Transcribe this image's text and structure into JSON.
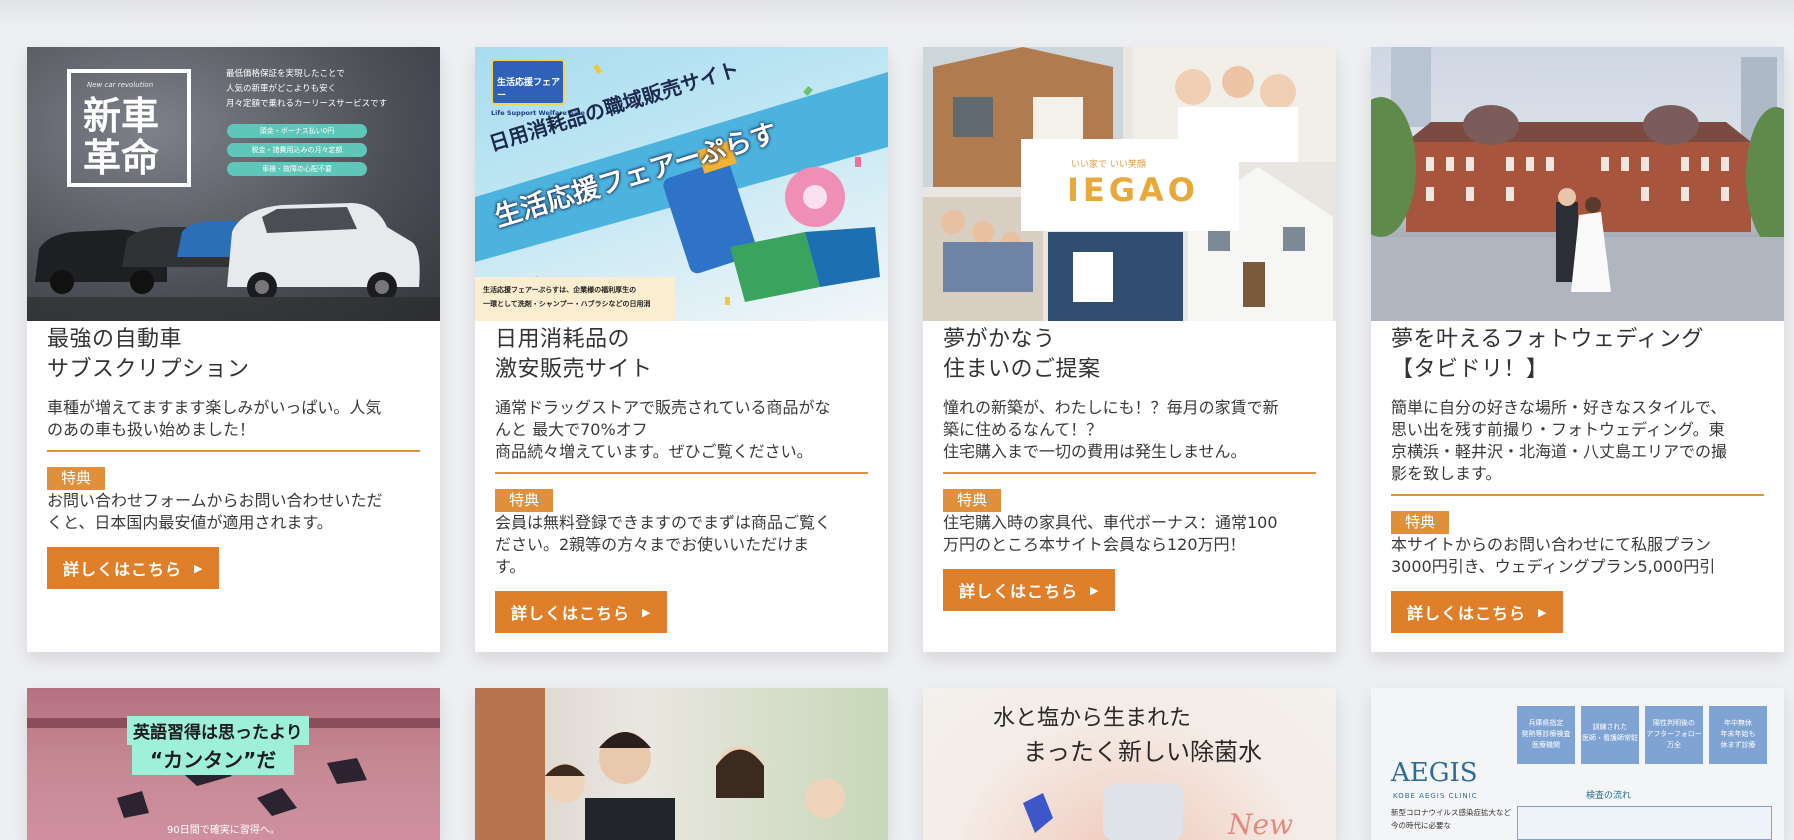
{
  "cards": [
    {
      "title": "最強の自動車\nサブスクリプション",
      "description": "車種が増えてますます楽しみがいっぱい。人気\nのあの車も扱い始めました！",
      "badge": "特典",
      "benefit": "お問い合わせフォームからお問い合わせいただ\nくと、日本国内最安値が適用されます。",
      "cta": "詳しくはこちら",
      "image": {
        "heading": "新車\n革命",
        "tagline": "New car revolution",
        "copy": "最低価格保証を実現したことで\n人気の新車がどこよりも安く\n月々定額で乗れるカーリースサービスです",
        "pills": [
          "頭金・ボーナス払い0円",
          "税金・諸費用込みの月々定額",
          "車検・故障の心配不要"
        ]
      }
    },
    {
      "title": "日用消耗品の\n激安販売サイト",
      "description": "通常ドラッグストアで販売されている商品がな\nんと 最大で70%オフ\n商品続々増えています。ぜひご覧ください。",
      "badge": "特典",
      "benefit": "会員は無料登録できますのでまずは商品ご覧く\nださい。2親等の方々までお使いいただけま\nす。",
      "cta": "詳しくはこちら",
      "image": {
        "line1": "日用消耗品の職域販売サイト",
        "line2": "生活応援フェアーぷらす",
        "badge": "生活応援フェアー",
        "sub": "Life Support Welfare Sale",
        "footer": "生活応援フェアーぷらすは、企業様の福利厚生の\n一環として洗剤・シャンプー・ハブラシなどの日用消"
      }
    },
    {
      "title": "夢がかなう\n住まいのご提案",
      "description": "憧れの新築が、わたしにも！？毎月の家賃で新\n築に住めるなんて！？\n住宅購入まで一切の費用は発生しません。",
      "badge": "特典",
      "benefit": "住宅購入時の家具代、車代ボーナス：通常100\n万円のところ本サイト会員なら120万円！",
      "cta": "詳しくはこちら",
      "image": {
        "logo": "IEGAO",
        "logo_sub": "いい家で いい笑顔"
      }
    },
    {
      "title": "夢を叶えるフォトウェディング\n【タビドリ！】",
      "description": "簡単に自分の好きな場所・好きなスタイルで、\n思い出を残す前撮り・フォトウェディング。東\n京横浜・軽井沢・北海道・八丈島エリアでの撮\n影を致します。",
      "badge": "特典",
      "benefit": "本サイトからのお問い合わせにて私服プラン\n3000円引き、ウェディングプラン5,000円引",
      "cta": "詳しくはこちら",
      "image": {}
    }
  ],
  "bottom_cards": [
    {
      "line1": "英語習得は思ったより",
      "line2": "“カンタン”だ",
      "footer": "90日間で確実に習得へ。"
    },
    {},
    {
      "line1": "水と塩から生まれた",
      "line2": "まったく新しい除菌水",
      "corner": "New"
    },
    {
      "logo": "AEGIS",
      "logo_sub": "KOBE AEGIS CLINIC",
      "caption": "新型コロナウイルス感染症拡大など\n今の時代に必要な",
      "boxes": [
        "兵庫県指定\n発熱等診療検査\n医療機関",
        "訓練された\n医師・看護師常駐",
        "陽性判明後の\nアフターフォロー\n万全",
        "年中無休\n年末年始も\n休まず診療"
      ],
      "flow": "検査の流れ"
    }
  ],
  "colors": {
    "accent": "#e07f2a",
    "badge": "#e0903b",
    "background": "#eeeff2"
  },
  "icons": {
    "cta_arrow": "▶"
  }
}
